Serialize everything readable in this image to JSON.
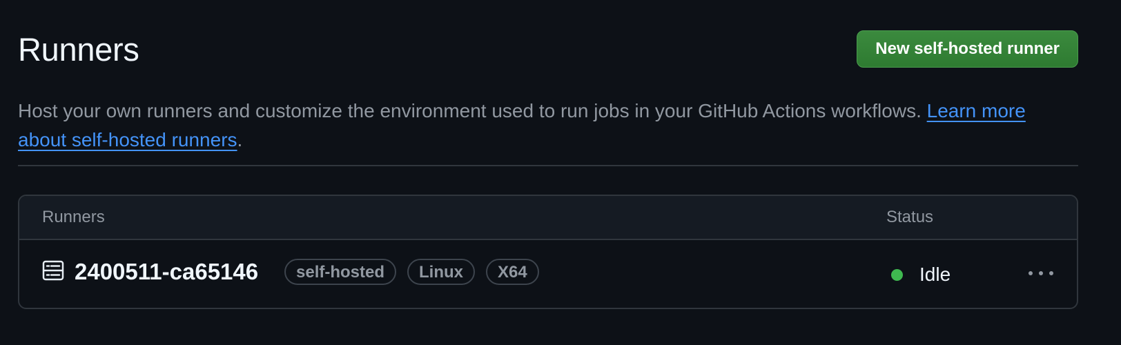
{
  "header": {
    "title": "Runners",
    "new_runner_label": "New self-hosted runner"
  },
  "description": {
    "text": "Host your own runners and customize the environment used to run jobs in your GitHub Actions workflows. ",
    "link_text": "Learn more about self-hosted runners",
    "suffix": "."
  },
  "table": {
    "columns": [
      "Runners",
      "Status"
    ],
    "rows": [
      {
        "icon": "server-icon",
        "name": "2400511-ca65146",
        "labels": [
          "self-hosted",
          "Linux",
          "X64"
        ],
        "status": "Idle",
        "status_color": "#3fb950",
        "actions_icon": "kebab-horizontal-icon"
      }
    ]
  },
  "colors": {
    "background": "#0d1117",
    "primary_button": "#2f7d32",
    "link": "#4493f8",
    "status_idle": "#3fb950"
  }
}
